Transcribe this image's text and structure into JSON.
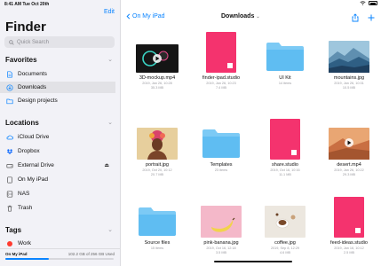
{
  "status": {
    "time": "8:41 AM  Tue Oct 20th"
  },
  "sidebar": {
    "edit_label": "Edit",
    "title": "Finder",
    "search_placeholder": "Quick Search",
    "favorites": {
      "header": "Favorites",
      "items": [
        {
          "label": "Documents",
          "icon": "document-icon"
        },
        {
          "label": "Downloads",
          "icon": "download-icon",
          "selected": true
        },
        {
          "label": "Design projects",
          "icon": "folder-icon"
        }
      ]
    },
    "locations": {
      "header": "Locations",
      "items": [
        {
          "label": "iCloud Drive",
          "icon": "cloud-icon"
        },
        {
          "label": "Dropbox",
          "icon": "dropbox-icon"
        },
        {
          "label": "External Drive",
          "icon": "drive-icon",
          "eject": "⏏"
        },
        {
          "label": "On My iPad",
          "icon": "ipad-icon"
        },
        {
          "label": "NAS",
          "icon": "server-icon"
        },
        {
          "label": "Trash",
          "icon": "trash-icon"
        }
      ]
    },
    "tags": {
      "header": "Tags",
      "items": [
        {
          "label": "Work",
          "color": "#ff3b30"
        }
      ]
    },
    "storage": {
      "label": "On My iPad",
      "used": "102.2 GB of 256 GB Used",
      "fill_fraction": 0.4
    }
  },
  "main": {
    "back_label": "On My iPad",
    "title": "Downloads",
    "files": [
      {
        "name": "3D-mockup.mp4",
        "meta1": "2019, Jan 26, 10:28",
        "meta2": "35.3 MB",
        "kind": "video-dark"
      },
      {
        "name": "finder-ipad.studio",
        "meta1": "2019, Jan 26, 10:23",
        "meta2": "7.4 MB",
        "kind": "studio"
      },
      {
        "name": "UI Kit",
        "meta1": "14 items",
        "meta2": "",
        "kind": "folder"
      },
      {
        "name": "mountains.jpg",
        "meta1": "2019, Jan 26, 10:31",
        "meta2": "10.5 MB",
        "kind": "mountains"
      },
      {
        "name": "portrait.jpg",
        "meta1": "2019, Oct 20, 10:12",
        "meta2": "20.7 MB",
        "kind": "portrait"
      },
      {
        "name": "Templates",
        "meta1": "23 items",
        "meta2": "",
        "kind": "folder"
      },
      {
        "name": "share.studio",
        "meta1": "2019, Oct 16, 10:16",
        "meta2": "11.1 MB",
        "kind": "studio"
      },
      {
        "name": "desert.mp4",
        "meta1": "2019, Jan 26, 10:22",
        "meta2": "29.3 MB",
        "kind": "desert"
      },
      {
        "name": "Source files",
        "meta1": "15 items",
        "meta2": "",
        "kind": "folder"
      },
      {
        "name": "pink-banana.jpg",
        "meta1": "2019, Oct 16, 12:18",
        "meta2": "3.5 MB",
        "kind": "banana"
      },
      {
        "name": "coffee.jpg",
        "meta1": "2019, Sep 8, 12:29",
        "meta2": "4.6 MB",
        "kind": "coffee"
      },
      {
        "name": "feed-ideas.studio",
        "meta1": "2019, Jan 16, 10:12",
        "meta2": "2.5 MB",
        "kind": "studio"
      }
    ]
  },
  "colors": {
    "accent": "#0a84ff",
    "studio": "#f4336e",
    "folder": "#6cc4f4",
    "tag_work": "#ff3b30"
  }
}
